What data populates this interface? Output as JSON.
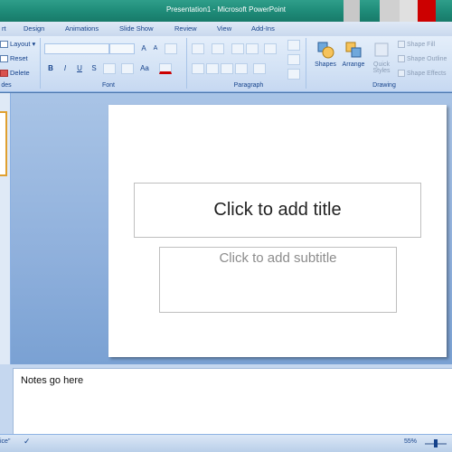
{
  "window": {
    "title": "Presentation1 - Microsoft PowerPoint"
  },
  "tabs": [
    {
      "label": "rt"
    },
    {
      "label": "Design"
    },
    {
      "label": "Animations"
    },
    {
      "label": "Slide Show"
    },
    {
      "label": "Review"
    },
    {
      "label": "View"
    },
    {
      "label": "Add-Ins"
    }
  ],
  "ribbon": {
    "slides": {
      "layout": "Layout",
      "reset": "Reset",
      "delete": "Delete",
      "group_label": "des"
    },
    "font": {
      "group_label": "Font",
      "bold": "B",
      "italic": "I",
      "underline": "U",
      "strike": "S",
      "grow": "A",
      "shrink": "A",
      "case": "Aa"
    },
    "paragraph": {
      "group_label": "Paragraph"
    },
    "drawing": {
      "group_label": "Drawing",
      "shapes": "Shapes",
      "arrange": "Arrange",
      "quick_styles": "Quick Styles",
      "shape_fill": "Shape Fill",
      "shape_outline": "Shape Outline",
      "shape_effects": "Shape Effects"
    }
  },
  "slide": {
    "title_placeholder": "Click to add title",
    "subtitle_placeholder": "Click to add subtitle"
  },
  "notes": {
    "text": "Notes go here"
  },
  "status": {
    "theme": "ice\"",
    "zoom": "55%"
  },
  "icons": [
    "layout-icon",
    "reset-icon",
    "delete-icon",
    "shapes-icon",
    "arrange-icon",
    "quick-styles-icon",
    "spellcheck-icon"
  ]
}
